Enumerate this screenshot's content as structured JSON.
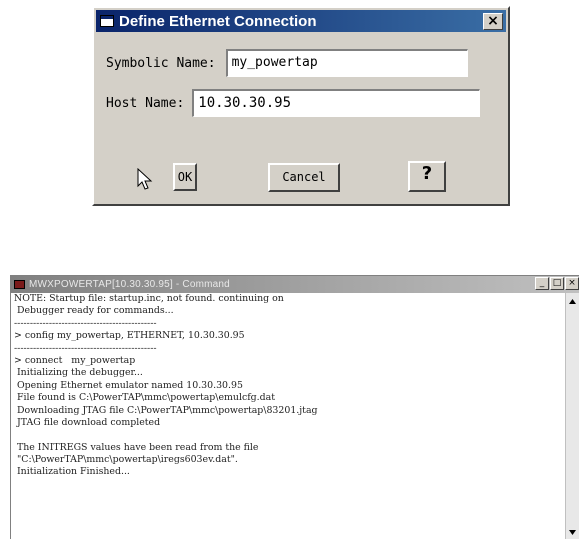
{
  "dialog": {
    "title": "Define Ethernet Connection",
    "close_glyph": "×",
    "symbolic_name_label": "Symbolic Name:",
    "symbolic_name_value": "my_powertap",
    "host_name_label": "Host Name:",
    "host_name_value": "10.30.30.95",
    "ok_label": "OK",
    "cancel_label": "Cancel",
    "help_label": "?"
  },
  "console": {
    "title": "MWXPOWERTAP[10.30.30.95] - Command",
    "controls": {
      "minimize": "_",
      "maximize": "□",
      "close": "×"
    },
    "lines": [
      "NOTE: Startup file: startup.inc, not found. continuing on",
      " Debugger ready for commands...",
      "---------------------------------------------",
      "> config my_powertap, ETHERNET, 10.30.30.95",
      "---------------------------------------------",
      "> connect   my_powertap",
      " Initializing the debugger...",
      " Opening Ethernet emulator named 10.30.30.95",
      " File found is C:\\PowerTAP\\mmc\\powertap\\emulcfg.dat",
      " Downloading JTAG file C:\\PowerTAP\\mmc\\powertap\\83201.jtag",
      " JTAG file download completed",
      "",
      " The INITREGS values have been read from the file",
      " \"C:\\PowerTAP\\mmc\\powertap\\iregs603ev.dat\".",
      " Initialization Finished..."
    ]
  }
}
